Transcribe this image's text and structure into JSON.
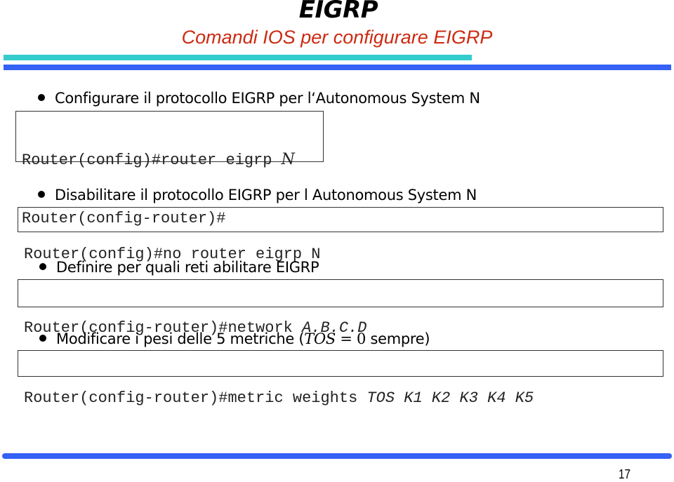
{
  "slide": {
    "title": "EIGRP",
    "subtitle": "Comandi IOS per configurare EIGRP",
    "page_number": "17",
    "colors": {
      "title": "#000000",
      "subtitle": "#cc2a11",
      "accent_teal": "#34cccc",
      "accent_blue": "#3561f5"
    }
  },
  "sections": [
    {
      "bullet": "Configurare il protocollo EIGRP per l‘Autonomous System N",
      "code": [
        {
          "prefix": "Router(config)#router eigrp ",
          "arg": "N"
        },
        {
          "prefix": "Router(config-router)#",
          "arg": ""
        }
      ]
    },
    {
      "bullet": "Disabilitare il protocollo EIGRP  per l Autonomous System N",
      "code": [
        {
          "prefix": "Router(config)#no router eigrp N",
          "arg": ""
        }
      ]
    },
    {
      "bullet": "Definire per quali reti abilitare EIGRP",
      "code": [
        {
          "prefix": "Router(config-router)#network ",
          "arg": "A.B.C.D"
        }
      ]
    },
    {
      "bullet_prefix": "Modificare i pesi delle 5 metriche (",
      "bullet_math_var": "TOS",
      "bullet_math_eq": " = 0",
      "bullet_suffix": " sempre)",
      "code": [
        {
          "prefix": "Router(config-router)#metric weights ",
          "arg": "TOS K1 K2 K3 K4 K5"
        }
      ]
    }
  ]
}
